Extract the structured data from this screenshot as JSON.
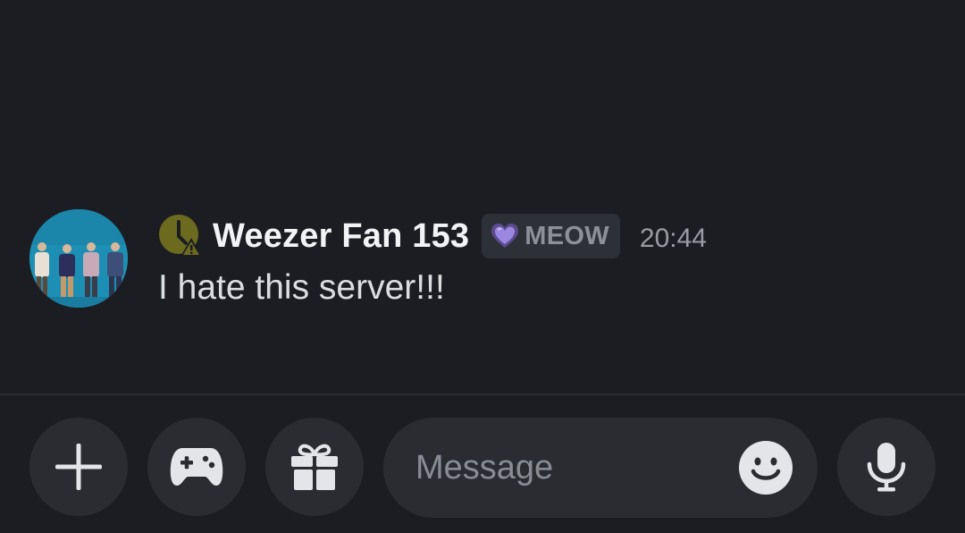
{
  "message": {
    "author": "Weezer Fan 153",
    "tag": "MEOW",
    "timestamp": "20:44",
    "content": "I hate this server!!!"
  },
  "input": {
    "placeholder": "Message"
  },
  "icons": {
    "avatar": "user-avatar-band-photo",
    "badge": "clock-warning-icon",
    "tag_icon": "purple-heart-icon",
    "add": "plus-icon",
    "games": "gamepad-icon",
    "gift": "gift-icon",
    "emoji": "smiley-icon",
    "voice": "microphone-icon"
  },
  "colors": {
    "background": "#1c1d22",
    "button_bg": "#2a2c32",
    "tag_bg": "#2e3037",
    "badge": "#6b6a1f",
    "heart": "#8f7bd6"
  }
}
